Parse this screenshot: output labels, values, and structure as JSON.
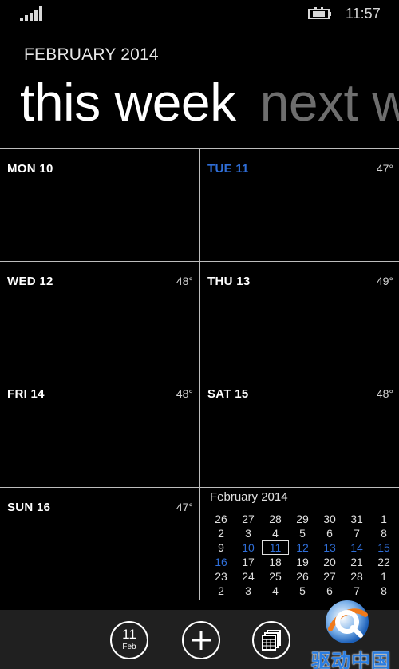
{
  "status": {
    "time": "11:57",
    "signal_bars": 5
  },
  "header": {
    "month_label": "FEBRUARY 2014",
    "pivot_active": "this week",
    "pivot_next": "next week"
  },
  "days": [
    {
      "label": "MON 10",
      "temp": "",
      "today": false
    },
    {
      "label": "TUE 11",
      "temp": "47°",
      "today": true
    },
    {
      "label": "WED 12",
      "temp": "48°",
      "today": false
    },
    {
      "label": "THU 13",
      "temp": "49°",
      "today": false
    },
    {
      "label": "FRI 14",
      "temp": "48°",
      "today": false
    },
    {
      "label": "SAT 15",
      "temp": "48°",
      "today": false
    },
    {
      "label": "SUN 16",
      "temp": "47°",
      "today": false
    }
  ],
  "mini_calendar": {
    "title": "February 2014",
    "weeks": [
      [
        "26",
        "27",
        "28",
        "29",
        "30",
        "31",
        "1"
      ],
      [
        "2",
        "3",
        "4",
        "5",
        "6",
        "7",
        "8"
      ],
      [
        "9",
        "10",
        "11",
        "12",
        "13",
        "14",
        "15"
      ],
      [
        "16",
        "17",
        "18",
        "19",
        "20",
        "21",
        "22"
      ],
      [
        "23",
        "24",
        "25",
        "26",
        "27",
        "28",
        "1"
      ],
      [
        "2",
        "3",
        "4",
        "5",
        "6",
        "7",
        "8"
      ]
    ],
    "highlighted_week": [
      "10",
      "11",
      "12",
      "13",
      "14",
      "15",
      "16"
    ],
    "selected_day": "11"
  },
  "appbar": {
    "today_number": "11",
    "today_month": "Feb",
    "add_icon": "add-icon",
    "calendar_icon": "month-view-icon"
  },
  "watermark": {
    "text": "驱动中国"
  },
  "colors": {
    "accent": "#2f6ed8",
    "background": "#000000",
    "appbar": "#202020",
    "divider": "#bdbdbd"
  }
}
